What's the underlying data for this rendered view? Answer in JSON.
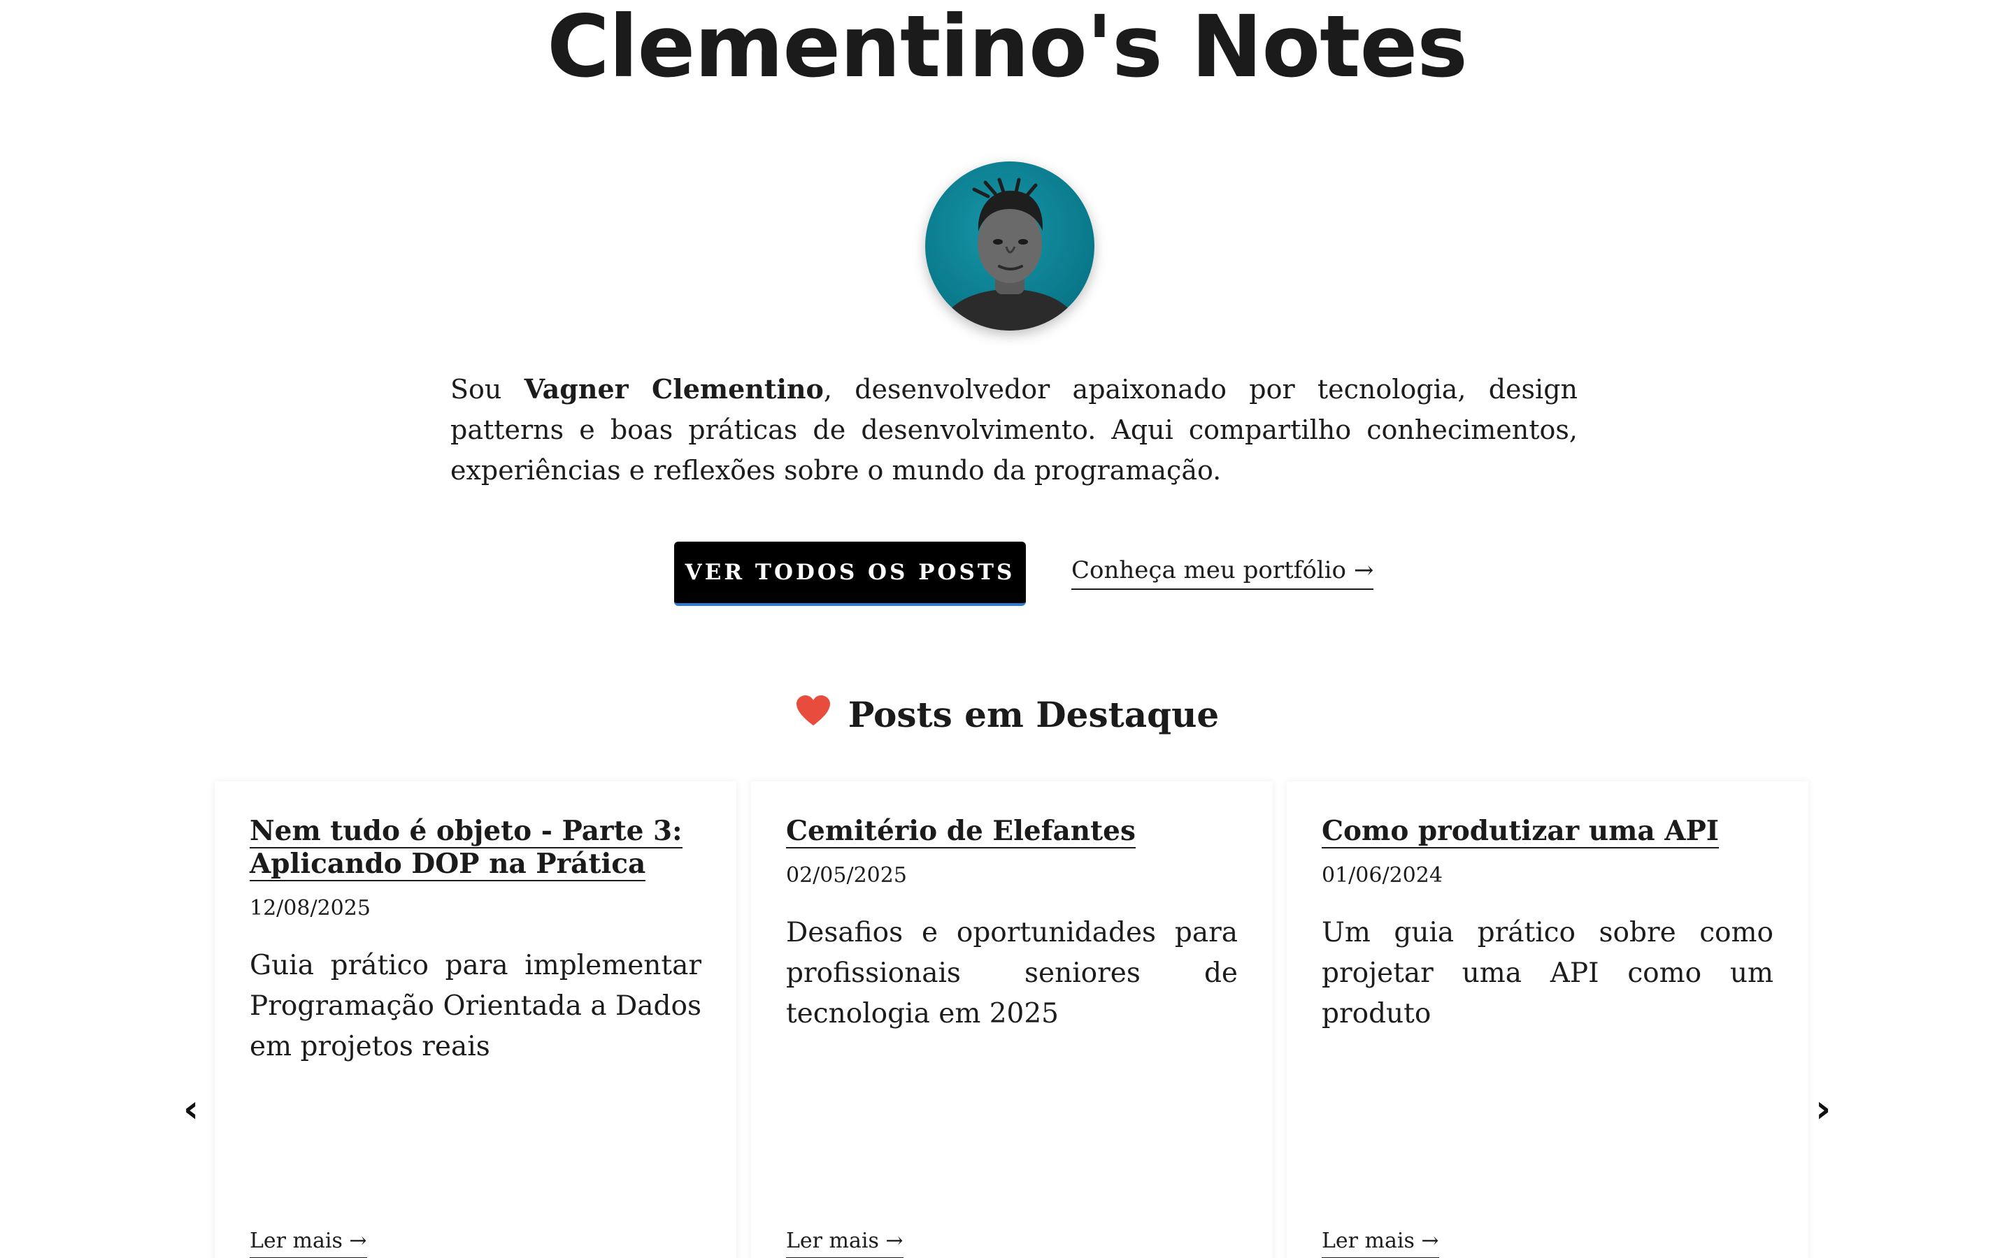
{
  "site": {
    "title": "Clementino's Notes"
  },
  "intro": {
    "prefix": "Sou ",
    "name": "Vagner Clementino",
    "text": ", desenvolvedor apaixonado por tecnologia, design patterns e boas práticas de desenvolvimento. Aqui compartilho conhecimentos, experiências e reflexões sobre o mundo da programação."
  },
  "actions": {
    "all_posts_label": "VER TODOS OS POSTS",
    "portfolio_label": "Conheça meu portfólio →"
  },
  "featured": {
    "heading": "Posts em Destaque",
    "icon": "heart-icon",
    "accent_color": "#e74c3c",
    "posts": [
      {
        "title": "Nem tudo é objeto - Parte 3: Aplicando DOP na Prática",
        "date": "12/08/2025",
        "description": "Guia prático para implementar Programação Orientada a Dados em projetos reais",
        "more_label": "Ler mais →"
      },
      {
        "title": "Cemitério de Elefantes",
        "date": "02/05/2025",
        "description": "Desafios e oportunidades para profissionais seniores de tecnologia em 2025",
        "more_label": "Ler mais →"
      },
      {
        "title": "Como produtizar uma API",
        "date": "01/06/2024",
        "description": "Um guia prático sobre como projetar uma API como um produto",
        "more_label": "Ler mais →"
      }
    ],
    "prev_label": "‹",
    "next_label": "›"
  }
}
